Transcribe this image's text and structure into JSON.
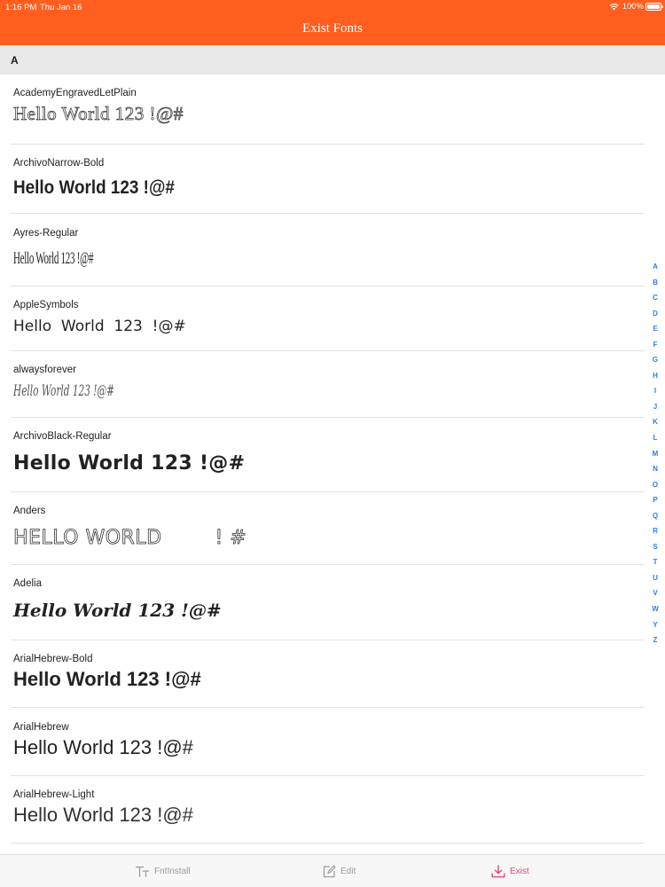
{
  "status_bar": {
    "time": "1:16 PM",
    "date": "Thu Jan 16",
    "battery": "100%",
    "icons": [
      "wifi-icon",
      "battery-icon"
    ]
  },
  "nav": {
    "title": "Exist Fonts"
  },
  "colors": {
    "accent": "#ff5e1f",
    "index": "#2b7fe8",
    "tab_active": "#e3457a",
    "tab_inactive": "#9a9a9a"
  },
  "section": {
    "letter": "A"
  },
  "fonts": [
    {
      "name": "AcademyEngravedLetPlain",
      "sample": "Hello World 123 !@#"
    },
    {
      "name": "ArchivoNarrow-Bold",
      "sample": "Hello World 123 !@#"
    },
    {
      "name": "Ayres-Regular",
      "sample": "Hello World 123 !@#"
    },
    {
      "name": "AppleSymbols",
      "sample": "Hello  World  123  !@#"
    },
    {
      "name": "alwaysforever",
      "sample": "Hello World 123 !@#"
    },
    {
      "name": "ArchivoBlack-Regular",
      "sample": "Hello World 123 !@#"
    },
    {
      "name": "Anders",
      "sample": "HELLO WORLD        ! #"
    },
    {
      "name": "Adelia",
      "sample": "Hello World 123 !@#"
    },
    {
      "name": "ArialHebrew-Bold",
      "sample": "Hello World 123 !@#"
    },
    {
      "name": "ArialHebrew",
      "sample": "Hello World 123 !@#"
    },
    {
      "name": "ArialHebrew-Light",
      "sample": "Hello World 123 !@#"
    }
  ],
  "index_letters": [
    "A",
    "B",
    "C",
    "D",
    "E",
    "F",
    "G",
    "H",
    "I",
    "J",
    "K",
    "L",
    "M",
    "N",
    "O",
    "P",
    "Q",
    "R",
    "S",
    "T",
    "U",
    "V",
    "W",
    "Y",
    "Z"
  ],
  "tabs": [
    {
      "label": "FntInstall",
      "icon": "font-size-icon",
      "active": false
    },
    {
      "label": "Edit",
      "icon": "edit-icon",
      "active": false
    },
    {
      "label": "Exist",
      "icon": "download-icon",
      "active": true
    }
  ]
}
